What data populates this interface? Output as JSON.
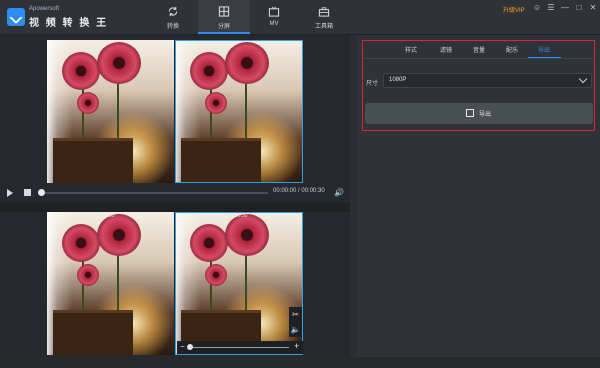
{
  "app": {
    "brand_small": "Apowersoft",
    "brand_name": "视 频 转 换 王",
    "vip_label": "升级VIP",
    "window_icons": [
      "user-icon",
      "list-icon",
      "minimize-icon",
      "maximize-icon",
      "close-icon"
    ]
  },
  "tabs": [
    {
      "label": "转换",
      "icon": "refresh-icon",
      "active": false
    },
    {
      "label": "分屏",
      "icon": "split-screen-icon",
      "active": true
    },
    {
      "label": "MV",
      "icon": "tv-icon",
      "active": false
    },
    {
      "label": "工具箱",
      "icon": "toolbox-icon",
      "active": false
    }
  ],
  "player": {
    "time": "00:00:00 / 00:00:30"
  },
  "clips": [
    {
      "timecode": "00:00:30"
    },
    {
      "timecode": "00:00:30"
    }
  ],
  "right_panel": {
    "tabs": [
      "样式",
      "滤镜",
      "音量",
      "配乐",
      "导出"
    ],
    "active_tab": "导出",
    "size_label": "尺寸",
    "size_value": "1080P",
    "export_label": "导出"
  },
  "colors": {
    "accent": "#2d8cf0",
    "highlight": "#e0223a",
    "vip": "#f5a623"
  }
}
